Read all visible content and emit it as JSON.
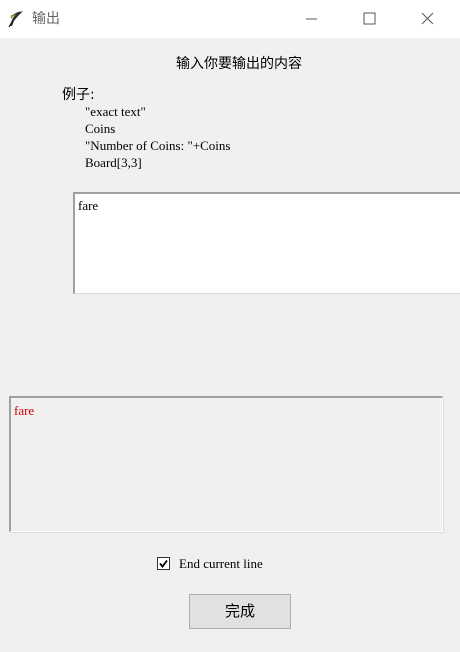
{
  "window": {
    "title": "输出",
    "icon": "feather-quill-icon",
    "controls": [
      "minimize-icon",
      "maximize-icon",
      "close-icon"
    ]
  },
  "dialog": {
    "heading": "输入你要输出的内容",
    "example_label": "例子:",
    "examples": [
      "\"exact text\"",
      "Coins",
      "\"Number of Coins: \"+Coins",
      "Board[3,3]"
    ],
    "input_value": "fare",
    "preview_text": "fare",
    "preview_color": "#cc0000",
    "checkbox": {
      "label": "End current line",
      "checked": true
    },
    "done_label": "完成"
  }
}
